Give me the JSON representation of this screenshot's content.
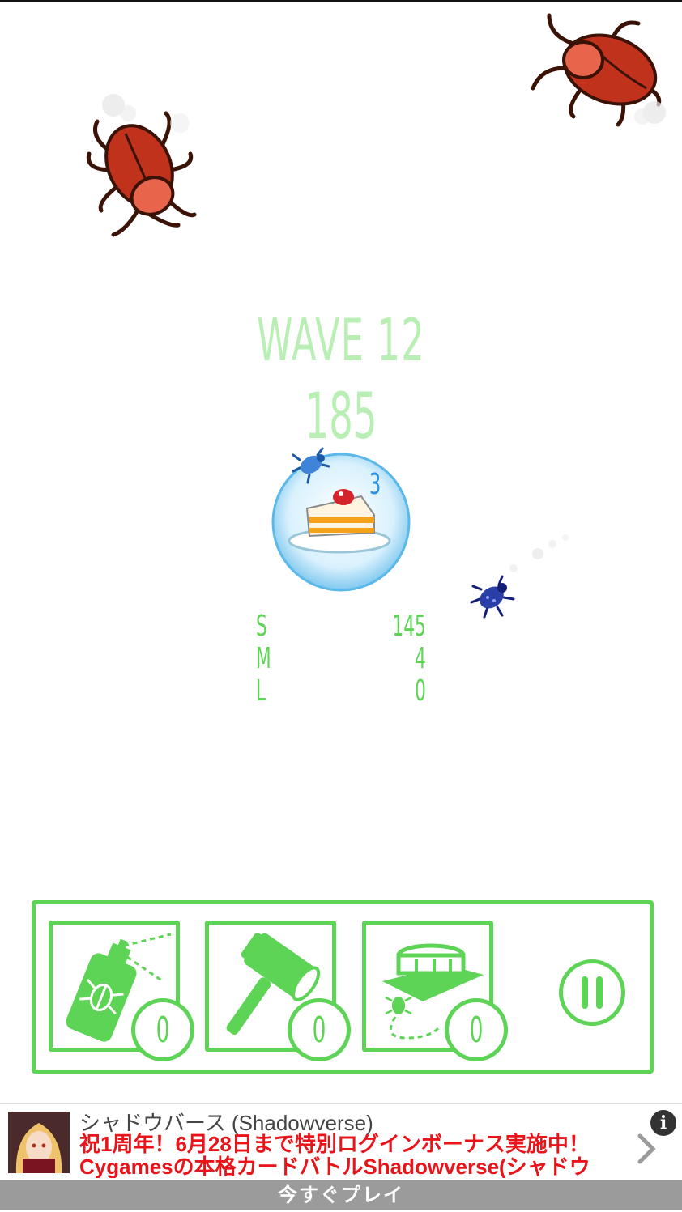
{
  "hud": {
    "wave_label": "WAVE 12",
    "score": "185",
    "cake_hits": "3"
  },
  "stats": [
    {
      "label": "S",
      "value": "145"
    },
    {
      "label": "M",
      "value": "4"
    },
    {
      "label": "L",
      "value": "0"
    }
  ],
  "tools": [
    {
      "name": "bug-spray",
      "count": "0"
    },
    {
      "name": "hammer",
      "count": "0"
    },
    {
      "name": "bug-trap",
      "count": "0"
    }
  ],
  "ad": {
    "title": "シャドウバース (Shadowverse)",
    "body": "祝1周年！6月28日まで特別ログインボーナス実施中！Cygamesの本格カードバトルShadowverse(シャドウバース)",
    "cta": "今すぐプレイ",
    "info": "i"
  },
  "colors": {
    "accent_green": "#5dd455",
    "pale_green": "#b9efb4",
    "beetle_red": "#c0321c",
    "bug_blue": "#2a3ea8",
    "bubble_blue": "#bfe6fb"
  }
}
